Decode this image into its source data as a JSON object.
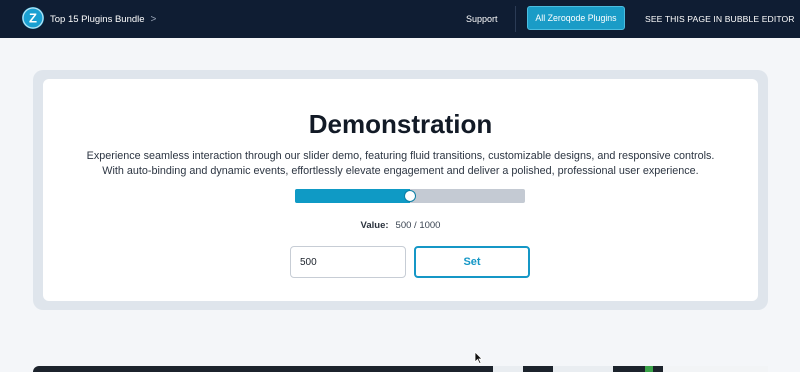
{
  "topbar": {
    "brand_title": "Top 15 Plugins Bundle",
    "brand_chevron": ">",
    "support_link": "Support",
    "plugins_button": "All Zeroqode Plugins",
    "editor_link": "SEE THIS PAGE IN BUBBLE EDITOR",
    "logo_letter": "Z",
    "logo_color": "#1aa0d2",
    "bar_color": "#0f1d33"
  },
  "demo": {
    "title": "Demonstration",
    "description_line1": "Experience seamless interaction through our slider demo, featuring fluid transitions, customizable designs, and responsive controls.",
    "description_line2": "With auto-binding and dynamic events, effortlessly elevate engagement and deliver a polished, professional user experience.",
    "slider": {
      "value": 500,
      "max": 1000,
      "fill_color": "#0f9ac5",
      "track_color": "#c4cad3"
    },
    "value_label": "Value:",
    "value_text": "500 / 1000",
    "input_value": "500",
    "set_button": "Set",
    "accent_color": "#1597c6"
  }
}
